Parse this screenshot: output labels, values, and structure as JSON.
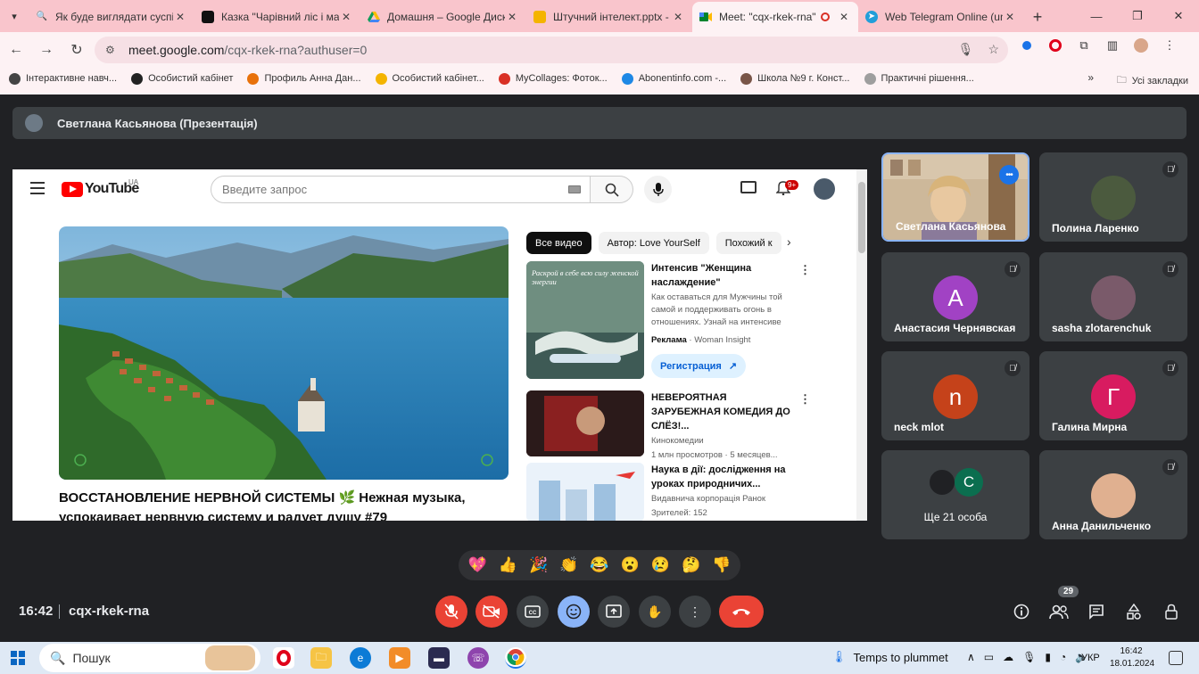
{
  "browser": {
    "tabs": [
      {
        "title": "Як буде виглядати суспільс",
        "color": "#1a73e8",
        "icon": "search-icon"
      },
      {
        "title": "Казка \"Чарівний ліс і маг",
        "color": "#111111",
        "icon": "app-icon"
      },
      {
        "title": "Домашня – Google Диск",
        "color": "#0f9d58",
        "icon": "drive-icon"
      },
      {
        "title": "Штучний інтелект.pptx - G",
        "color": "#f4b400",
        "icon": "slides-icon"
      },
      {
        "title": "Meet: \"cqx-rkek-rna\"",
        "color": "#00897b",
        "icon": "meet-icon",
        "active": true
      },
      {
        "title": "Web Telegram Online (unc",
        "color": "#229ed9",
        "icon": "telegram-icon"
      }
    ],
    "url_host": "meet.google.com",
    "url_path": "/cqx-rkek-rna?authuser=0",
    "bookmarks": [
      {
        "label": "Інтерактивне навч...",
        "color": "#444444"
      },
      {
        "label": "Особистий кабінет",
        "color": "#222222"
      },
      {
        "label": "Профиль Анна Дан...",
        "color": "#e8710a"
      },
      {
        "label": "Особистий кабінет...",
        "color": "#f4b400"
      },
      {
        "label": "MyCollages: Фоток...",
        "color": "#d93025"
      },
      {
        "label": "Abonentinfo.com -...",
        "color": "#1e88e5"
      },
      {
        "label": "Школа №9 г. Конст...",
        "color": "#795548"
      },
      {
        "label": "Практичні рішення...",
        "color": "#9e9e9e"
      }
    ],
    "bookmarks_all": "Усі закладки"
  },
  "meet": {
    "presenter_label": "Светлана Касьянова (Презентація)",
    "time": "16:42",
    "meeting_code": "cqx-rkek-rna",
    "participant_count": "29",
    "participants": [
      {
        "name": "Светлана Касьянова",
        "speaking": true,
        "type": "video"
      },
      {
        "name": "Полина Ларенко",
        "type": "photo",
        "color": "#4b5a3e"
      },
      {
        "name": "Анастасия Чернявская",
        "type": "letter",
        "letter": "A",
        "color": "#a142c4"
      },
      {
        "name": "sasha zlotarenchuk",
        "type": "photo",
        "color": "#7a5a6a"
      },
      {
        "name": "neck mlot",
        "type": "letter",
        "letter": "n",
        "color": "#c5421a"
      },
      {
        "name": "Галина Мирна",
        "type": "letter",
        "letter": "Г",
        "color": "#d81b60"
      },
      {
        "name": "Ще 21 особа",
        "type": "more",
        "letter": "C",
        "color": "#0b6e4f"
      },
      {
        "name": "Анна Данильченко",
        "type": "photo",
        "color": "#e0b090"
      }
    ],
    "reactions": [
      "💖",
      "👍",
      "🎉",
      "👏",
      "😂",
      "😮",
      "😢",
      "🤔",
      "👎"
    ]
  },
  "youtube": {
    "country": "UA",
    "search_placeholder": "Введите запрос",
    "notif_badge": "9+",
    "video_title": "ВОССТАНОВЛЕНИЕ НЕРВНОЙ СИСТЕМЫ 🌿 Нежная музыка, успокаивает нервную систему и радует душу #79",
    "chips": [
      "Все видео",
      "Автор: Love YourSelf",
      "Похожий к"
    ],
    "recs": [
      {
        "title": "Интенсив \"Женщина наслаждение\"",
        "desc": "Как оставаться для Мужчины той самой и поддерживать огонь в отношениях. Узнай на интенсиве",
        "ad_label": "Реклама",
        "channel": "Woman Insight",
        "button": "Регистрация",
        "thumb_text": "Раскрой в себе всю силу женской энергии"
      },
      {
        "title": "НЕВЕРОЯТНАЯ ЗАРУБЕЖНАЯ КОМЕДИЯ ДО СЛЁЗ!...",
        "channel": "Кинокомедии",
        "meta": "1 млн просмотров · 5 месяцев..."
      },
      {
        "title": "Наука в дії: дослідження на уроках природничих...",
        "channel": "Видавнича корпорація Ранок",
        "meta": "Зрителей: 152"
      }
    ]
  },
  "taskbar": {
    "search_label": "Пошук",
    "weather": "Temps to plummet",
    "lang": "УКР",
    "time": "16:42",
    "date": "18.01.2024"
  }
}
